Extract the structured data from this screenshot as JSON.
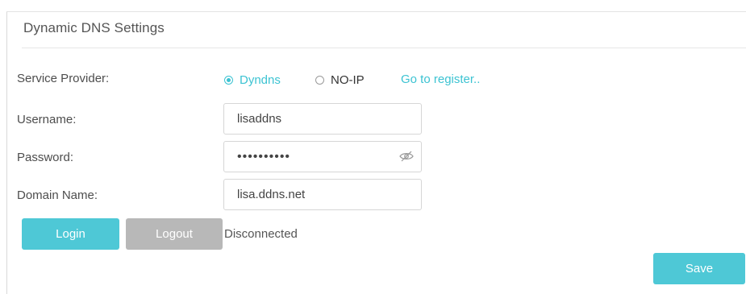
{
  "panel": {
    "title": "Dynamic DNS Settings"
  },
  "service_provider": {
    "label": "Service Provider:",
    "options": [
      {
        "label": "Dyndns",
        "selected": true
      },
      {
        "label": "NO-IP",
        "selected": false
      }
    ],
    "register_link": "Go to register.."
  },
  "username": {
    "label": "Username:",
    "value": "lisaddns"
  },
  "password": {
    "label": "Password:",
    "value": "••••••••••"
  },
  "domain": {
    "label": "Domain Name:",
    "value": "lisa.ddns.net"
  },
  "actions": {
    "login": "Login",
    "logout": "Logout",
    "status": "Disconnected",
    "save": "Save"
  },
  "colors": {
    "accent": "#4ec8d6",
    "disabled": "#b8b8b8"
  },
  "icons": {
    "password_toggle": "eye-off-icon"
  }
}
